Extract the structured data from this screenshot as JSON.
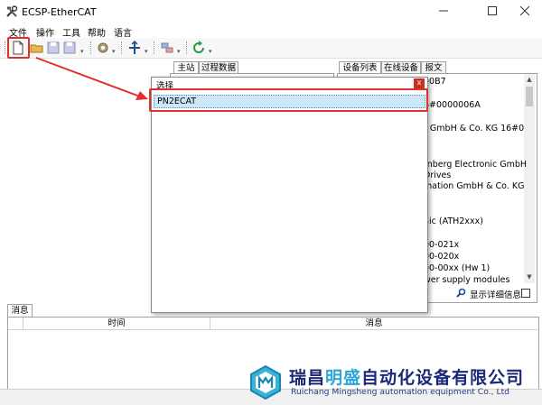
{
  "window": {
    "title": "ECSP-EtherCAT"
  },
  "menu": {
    "items": [
      "文件",
      "操作",
      "工具",
      "帮助",
      "语言"
    ]
  },
  "toolbar": {
    "icons": [
      "new-file-icon",
      "open-folder-icon",
      "save-icon",
      "save-as-icon",
      "settings-icon",
      "network-icon",
      "scan-icon",
      "refresh-icon"
    ]
  },
  "middle": {
    "tabs": [
      "主站",
      "过程数据"
    ]
  },
  "right": {
    "tabs": [
      "设备列表",
      "在线设备",
      "报文"
    ],
    "lines": [
      "00B7",
      "6#0000006A",
      "r GmbH & Co. KG   16#0",
      "rnberg Electronic GmbH",
      "Drives",
      "mation GmbH & Co. KG",
      "nic (ATH2xxx)",
      "00-021x",
      "00-020x",
      "00-00xx (Hw 1)",
      "wer supply modules"
    ],
    "detail_label": "显示详细信息"
  },
  "dialog": {
    "title": "选择",
    "item": "PN2ECAT"
  },
  "messages": {
    "tab": "消息",
    "col_time": "时间",
    "col_message": "消息"
  },
  "watermark": {
    "cn": "瑞昌明盛自动化设备有限公司",
    "en": "Ruichang Mingsheng automation equipment Co., Ltd"
  },
  "colors": {
    "highlight_red": "#e0302a",
    "selection_blue": "#cde8fb",
    "brand_blue": "#1a2a78"
  }
}
